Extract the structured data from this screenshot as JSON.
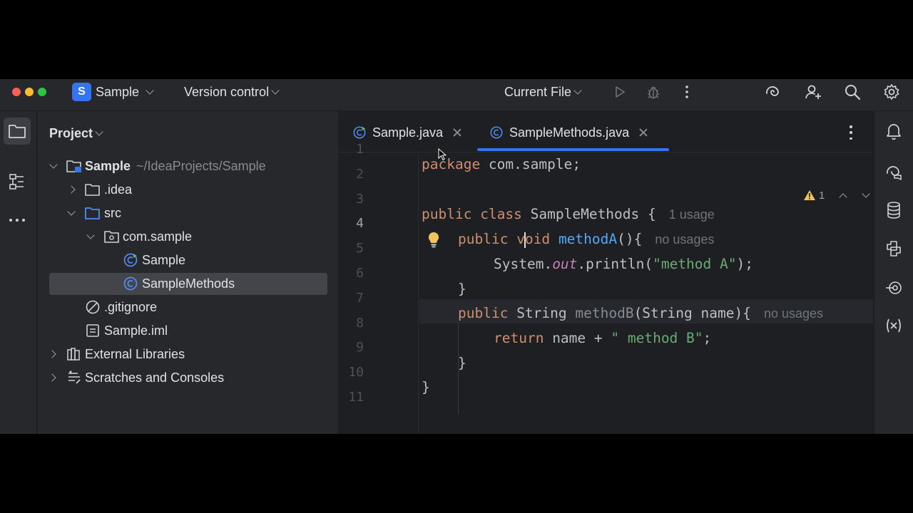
{
  "titlebar": {
    "project_badge": "S",
    "project_name": "Sample",
    "vcs_label": "Version control",
    "run_config": "Current File"
  },
  "project_panel": {
    "title": "Project",
    "tree": [
      {
        "label": "Sample",
        "path": "~/IdeaProjects/Sample",
        "icon": "module-folder-icon",
        "expanded": true
      },
      {
        "label": ".idea",
        "icon": "folder-icon",
        "expanded": false
      },
      {
        "label": "src",
        "icon": "source-folder-icon",
        "expanded": true
      },
      {
        "label": "com.sample",
        "icon": "package-icon",
        "expanded": true
      },
      {
        "label": "Sample",
        "icon": "java-main-class-icon"
      },
      {
        "label": "SampleMethods",
        "icon": "java-class-icon",
        "selected": true
      },
      {
        "label": ".gitignore",
        "icon": "ignored-file-icon"
      },
      {
        "label": "Sample.iml",
        "icon": "module-file-icon"
      },
      {
        "label": "External Libraries",
        "icon": "libraries-icon",
        "expanded": false
      },
      {
        "label": "Scratches and Consoles",
        "icon": "scratches-icon",
        "expanded": false
      }
    ]
  },
  "editor": {
    "tabs": [
      {
        "label": "Sample.java",
        "active": false
      },
      {
        "label": "SampleMethods.java",
        "active": true
      }
    ],
    "inspection_count": "1",
    "line_numbers": [
      "1",
      "2",
      "3",
      "4",
      "5",
      "6",
      "7",
      "8",
      "9",
      "10",
      "11"
    ],
    "current_line": 4,
    "code": {
      "l1_kw": "package",
      "l1_rest": " com.sample;",
      "l3_kw1": "public",
      "l3_kw2": "class",
      "l3_name": " SampleMethods {",
      "l3_hint": "1 usage",
      "l4_kw1": "public",
      "l4_kw2a": "v",
      "l4_kw2b": "oid",
      "l4_fn": "methodA",
      "l4_rest": "(){",
      "l4_hint": "no usages",
      "l5_a": "System.",
      "l5_static": "out",
      "l5_b": ".println(",
      "l5_str": "\"method A\"",
      "l5_c": ");",
      "l6": "}",
      "l7_kw1": "public",
      "l7_type": " String ",
      "l7_fn": "methodB",
      "l7_rest": "(String name){",
      "l7_hint": "no usages",
      "l8_kw": "return",
      "l8_a": " name + ",
      "l8_str": "\" method B\"",
      "l8_b": ";",
      "l9": "}",
      "l10": "}"
    }
  }
}
